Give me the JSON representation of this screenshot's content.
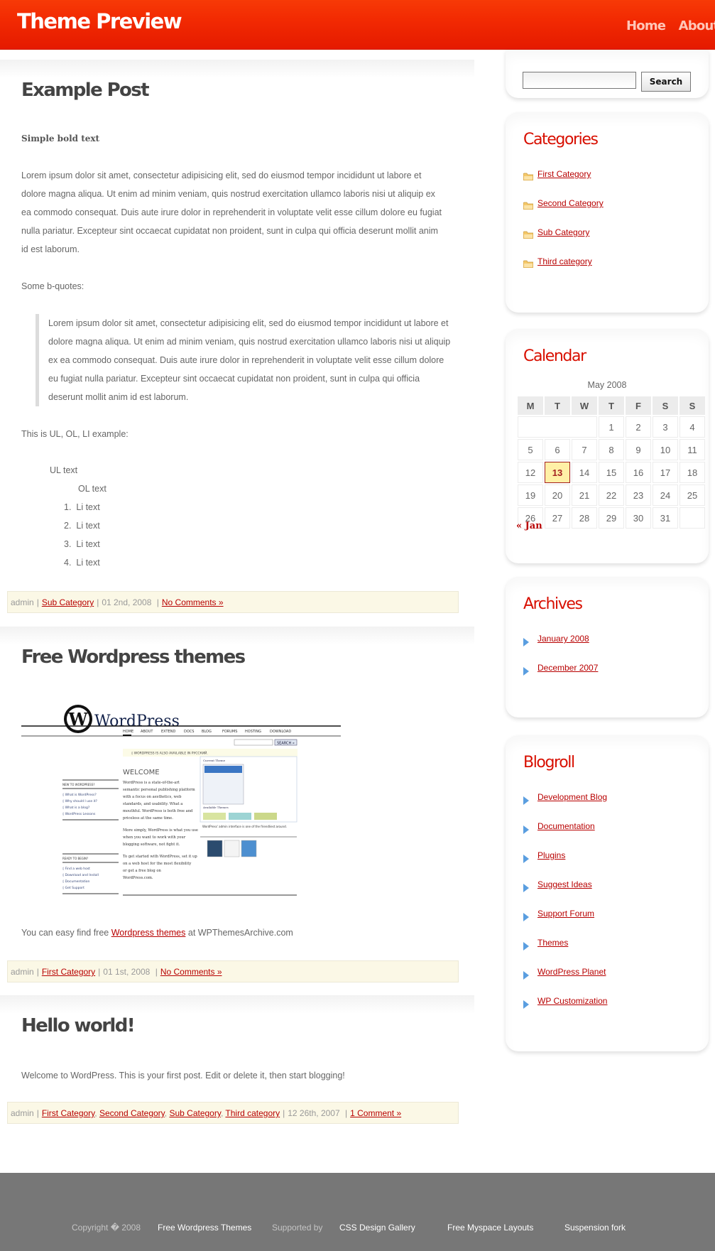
{
  "header": {
    "site_title": "Theme Preview",
    "nav": [
      "Home",
      "About"
    ]
  },
  "posts": [
    {
      "title": "Example Post",
      "bold_text": "Simple bold text",
      "paragraph": "Lorem ipsum dolor sit amet, consectetur adipisicing elit, sed do eiusmod tempor incididunt ut labore et dolore magna aliqua. Ut enim ad minim veniam, quis nostrud exercitation ullamco laboris nisi ut aliquip ex ea commodo consequat. Duis aute irure dolor in reprehenderit in voluptate velit esse cillum dolore eu fugiat nulla pariatur. Excepteur sint occaecat cupidatat non proident, sunt in culpa qui officia deserunt mollit anim id est laborum.",
      "bquote_label": "Some b-quotes:",
      "blockquote": "Lorem ipsum dolor sit amet, consectetur adipisicing elit, sed do eiusmod tempor incididunt ut labore et dolore magna aliqua. Ut enim ad minim veniam, quis nostrud exercitation ullamco laboris nisi ut aliquip ex ea commodo consequat. Duis aute irure dolor in reprehenderit in voluptate velit esse cillum dolore eu fugiat nulla pariatur. Excepteur sint occaecat cupidatat non proident, sunt in culpa qui officia deserunt mollit anim id est laborum.",
      "list_label": "This is UL, OL, LI example:",
      "ul_text": "UL text",
      "ol_text": "OL text",
      "li_items": [
        "1.  Li text",
        "2.  Li text",
        "3.  Li text",
        "4.  Li text"
      ],
      "meta": {
        "author": "admin",
        "categories": [
          "Sub Category"
        ],
        "date": "01 2nd, 2008",
        "comments": "No Comments »"
      }
    },
    {
      "title": "Free Wordpress themes",
      "image_alt": "WordPress homepage screenshot",
      "text_before": "You can easy find free ",
      "link": "Wordpress themes",
      "text_after": " at WPThemesArchive.com",
      "meta": {
        "author": "admin",
        "categories": [
          "First Category"
        ],
        "date": "01 1st, 2008",
        "comments": "No Comments »"
      }
    },
    {
      "title": "Hello world!",
      "paragraph": "Welcome to WordPress. This is your first post. Edit or delete it, then start blogging!",
      "meta": {
        "author": "admin",
        "categories": [
          "First Category",
          "Second Category",
          "Sub Category",
          "Third category"
        ],
        "date": "12 26th, 2007",
        "comments": "1 Comment »"
      }
    }
  ],
  "wp_screenshot": {
    "logo": "WordPress",
    "nav": [
      "HOME",
      "ABOUT",
      "EXTEND",
      "DOCS",
      "BLOG",
      "FORUMS",
      "HOSTING",
      "DOWNLOAD"
    ],
    "search_btn": "SEARCH »",
    "notice": "◊ WORDPRESS IS ALSO AVAILABLE IN РУССКИЙ.",
    "welcome": "WELCOME",
    "new_heading": "NEW TO WORDPRESS?",
    "new_links": [
      "◊ What is WordPress?",
      "◊ Why should I use it?",
      "◊ What is a blog?",
      "◊ WordPress Lessons"
    ],
    "ready_heading": "READY TO BEGIN?",
    "ready_links": [
      "◊ Find a web host",
      "◊ Download and Install",
      "◊ Documentation",
      "◊ Get Support"
    ],
    "body1": "WordPress is a state-of-the-art semantic personal publishing platform with a focus on aesthetics, web standards, and usability. What a mouthful. WordPress is both free and priceless at the same time.",
    "body2": "More simply, WordPress is what you use when you want to work with your blogging software, not fight it.",
    "body3": "To get started with WordPress, set it up on a web host for the most flexibility or get a free blog on WordPress.com.",
    "current_theme": "Current Theme",
    "available_themes": "Available Themes",
    "caption": "WordPress' admin interface is one of the friendliest around."
  },
  "sidebar": {
    "search": {
      "placeholder": "",
      "value": "",
      "button": "Search"
    },
    "categories": {
      "title": "Categories",
      "items": [
        "First Category",
        "Second Category",
        "Sub Category",
        "Third category"
      ]
    },
    "calendar": {
      "title": "Calendar",
      "caption": "May 2008",
      "weekdays": [
        "M",
        "T",
        "W",
        "T",
        "F",
        "S",
        "S"
      ],
      "weeks": [
        [
          "",
          "",
          "",
          "1",
          "2",
          "3",
          "4"
        ],
        [
          "5",
          "6",
          "7",
          "8",
          "9",
          "10",
          "11"
        ],
        [
          "12",
          "13",
          "14",
          "15",
          "16",
          "17",
          "18"
        ],
        [
          "19",
          "20",
          "21",
          "22",
          "23",
          "24",
          "25"
        ],
        [
          "26",
          "27",
          "28",
          "29",
          "30",
          "31",
          ""
        ]
      ],
      "today": "13",
      "prev_link": "« Jan"
    },
    "archives": {
      "title": "Archives",
      "items": [
        "January 2008",
        "December 2007"
      ]
    },
    "blogroll": {
      "title": "Blogroll",
      "items": [
        "Development Blog",
        "Documentation",
        "Plugins",
        "Suggest Ideas",
        "Support Forum",
        "Themes",
        "WordPress Planet",
        "WP Customization"
      ]
    }
  },
  "footer": {
    "copyright": "Copyright � 2008",
    "free_themes": "Free Wordpress Themes",
    "supported_by": "Supported by",
    "css_gallery": "CSS Design Gallery",
    "myspace": "Free Myspace Layouts",
    "suspension": "Suspension fork"
  },
  "colors": {
    "header_red": "#f22a02",
    "link_red": "#b80000",
    "widget_title_red": "#d80f00",
    "meta_bg": "#fbf8e6",
    "footer_gray": "#777777",
    "today_bg": "#fff0a6"
  }
}
